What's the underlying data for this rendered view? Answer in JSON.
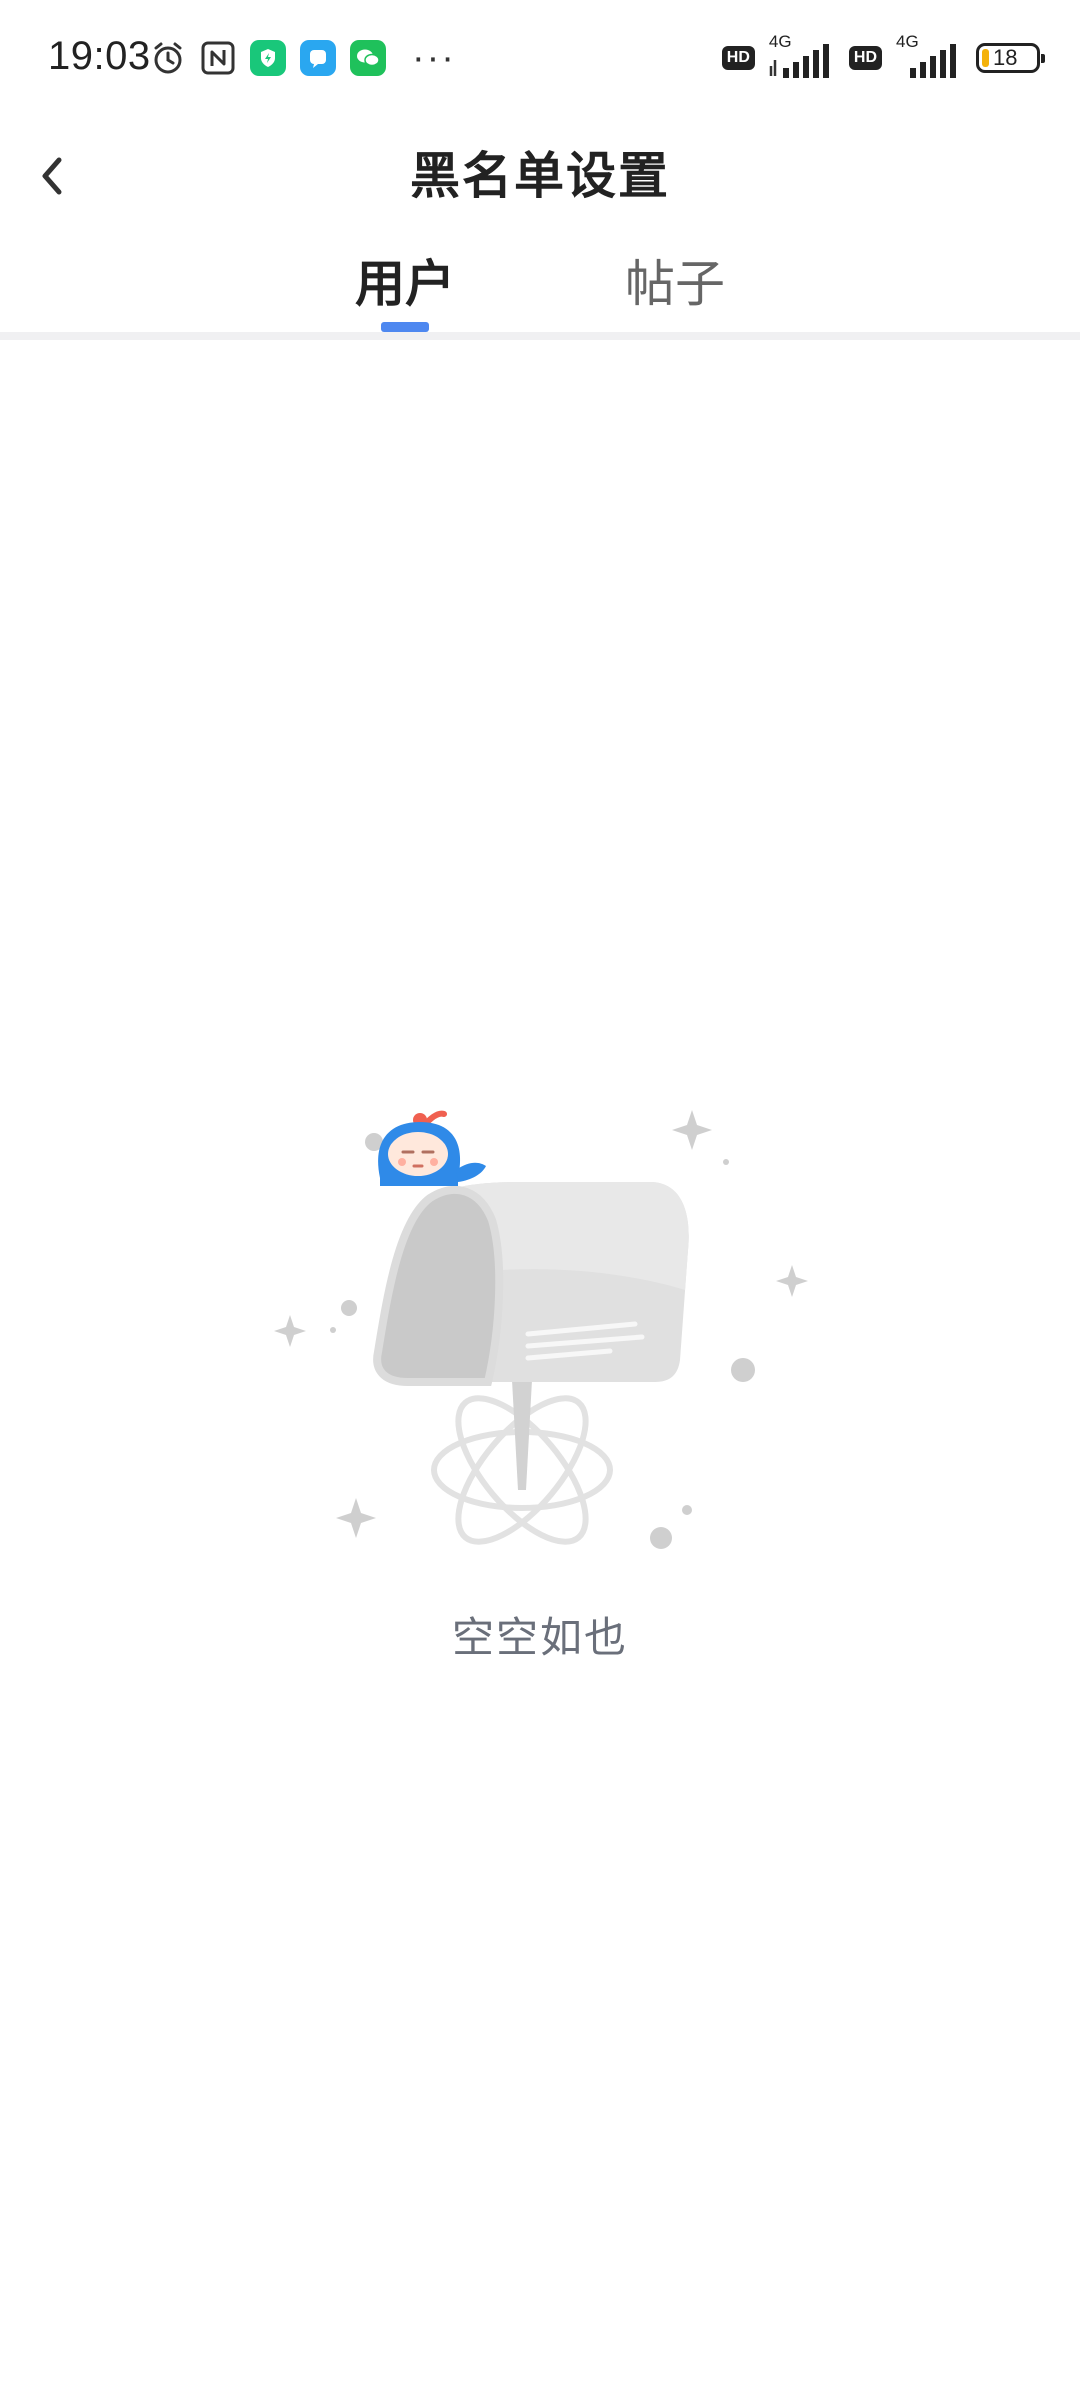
{
  "status_bar": {
    "time": "19:03",
    "icons": [
      "alarm-icon",
      "nfc-icon",
      "shield-app-icon",
      "chat-app-icon",
      "wechat-icon"
    ],
    "more": "···",
    "sim1": {
      "hd": "HD",
      "network": "4G"
    },
    "sim2": {
      "hd": "HD",
      "network": "4G"
    },
    "battery_level": "18"
  },
  "header": {
    "title": "黑名单设置",
    "back_icon": "chevron-left-icon"
  },
  "tabs": [
    {
      "label": "用户",
      "active": true
    },
    {
      "label": "帖子",
      "active": false
    }
  ],
  "empty_state": {
    "illustration": "mailbox-illustration",
    "message": "空空如也"
  },
  "colors": {
    "accent": "#4e88f0",
    "empty_text": "#6a6f7a",
    "divider": "#f0f0f2"
  }
}
